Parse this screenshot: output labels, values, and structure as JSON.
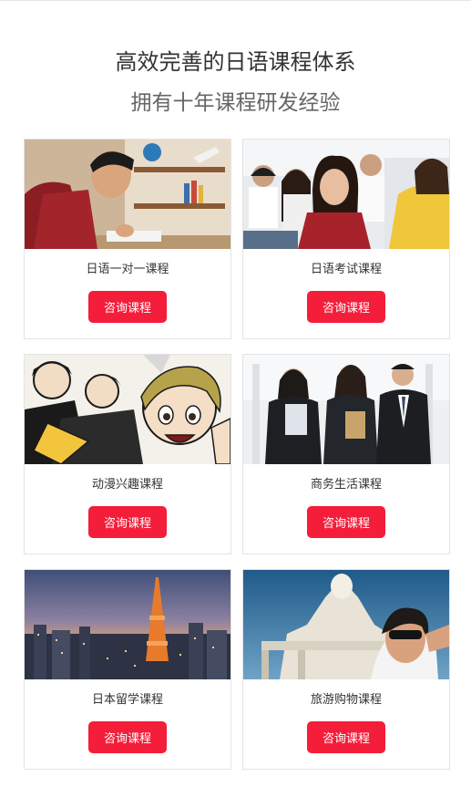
{
  "header": {
    "title": "高效完善的日语课程体系",
    "subtitle": "拥有十年课程研发经验"
  },
  "courses": [
    {
      "label": "日语一对一课程",
      "button": "咨询课程",
      "image": "student-studying-photo"
    },
    {
      "label": "日语考试课程",
      "button": "咨询课程",
      "image": "classroom-students-photo"
    },
    {
      "label": "动漫兴趣课程",
      "button": "咨询课程",
      "image": "anime-characters-illustration"
    },
    {
      "label": "商务生活课程",
      "button": "咨询课程",
      "image": "business-people-photo"
    },
    {
      "label": "日本留学课程",
      "button": "咨询课程",
      "image": "tokyo-tower-photo"
    },
    {
      "label": "旅游购物课程",
      "button": "咨询课程",
      "image": "tourist-selfie-photo"
    }
  ],
  "colors": {
    "accent": "#f41d3a",
    "title": "#333333",
    "subtitle": "#666666"
  }
}
